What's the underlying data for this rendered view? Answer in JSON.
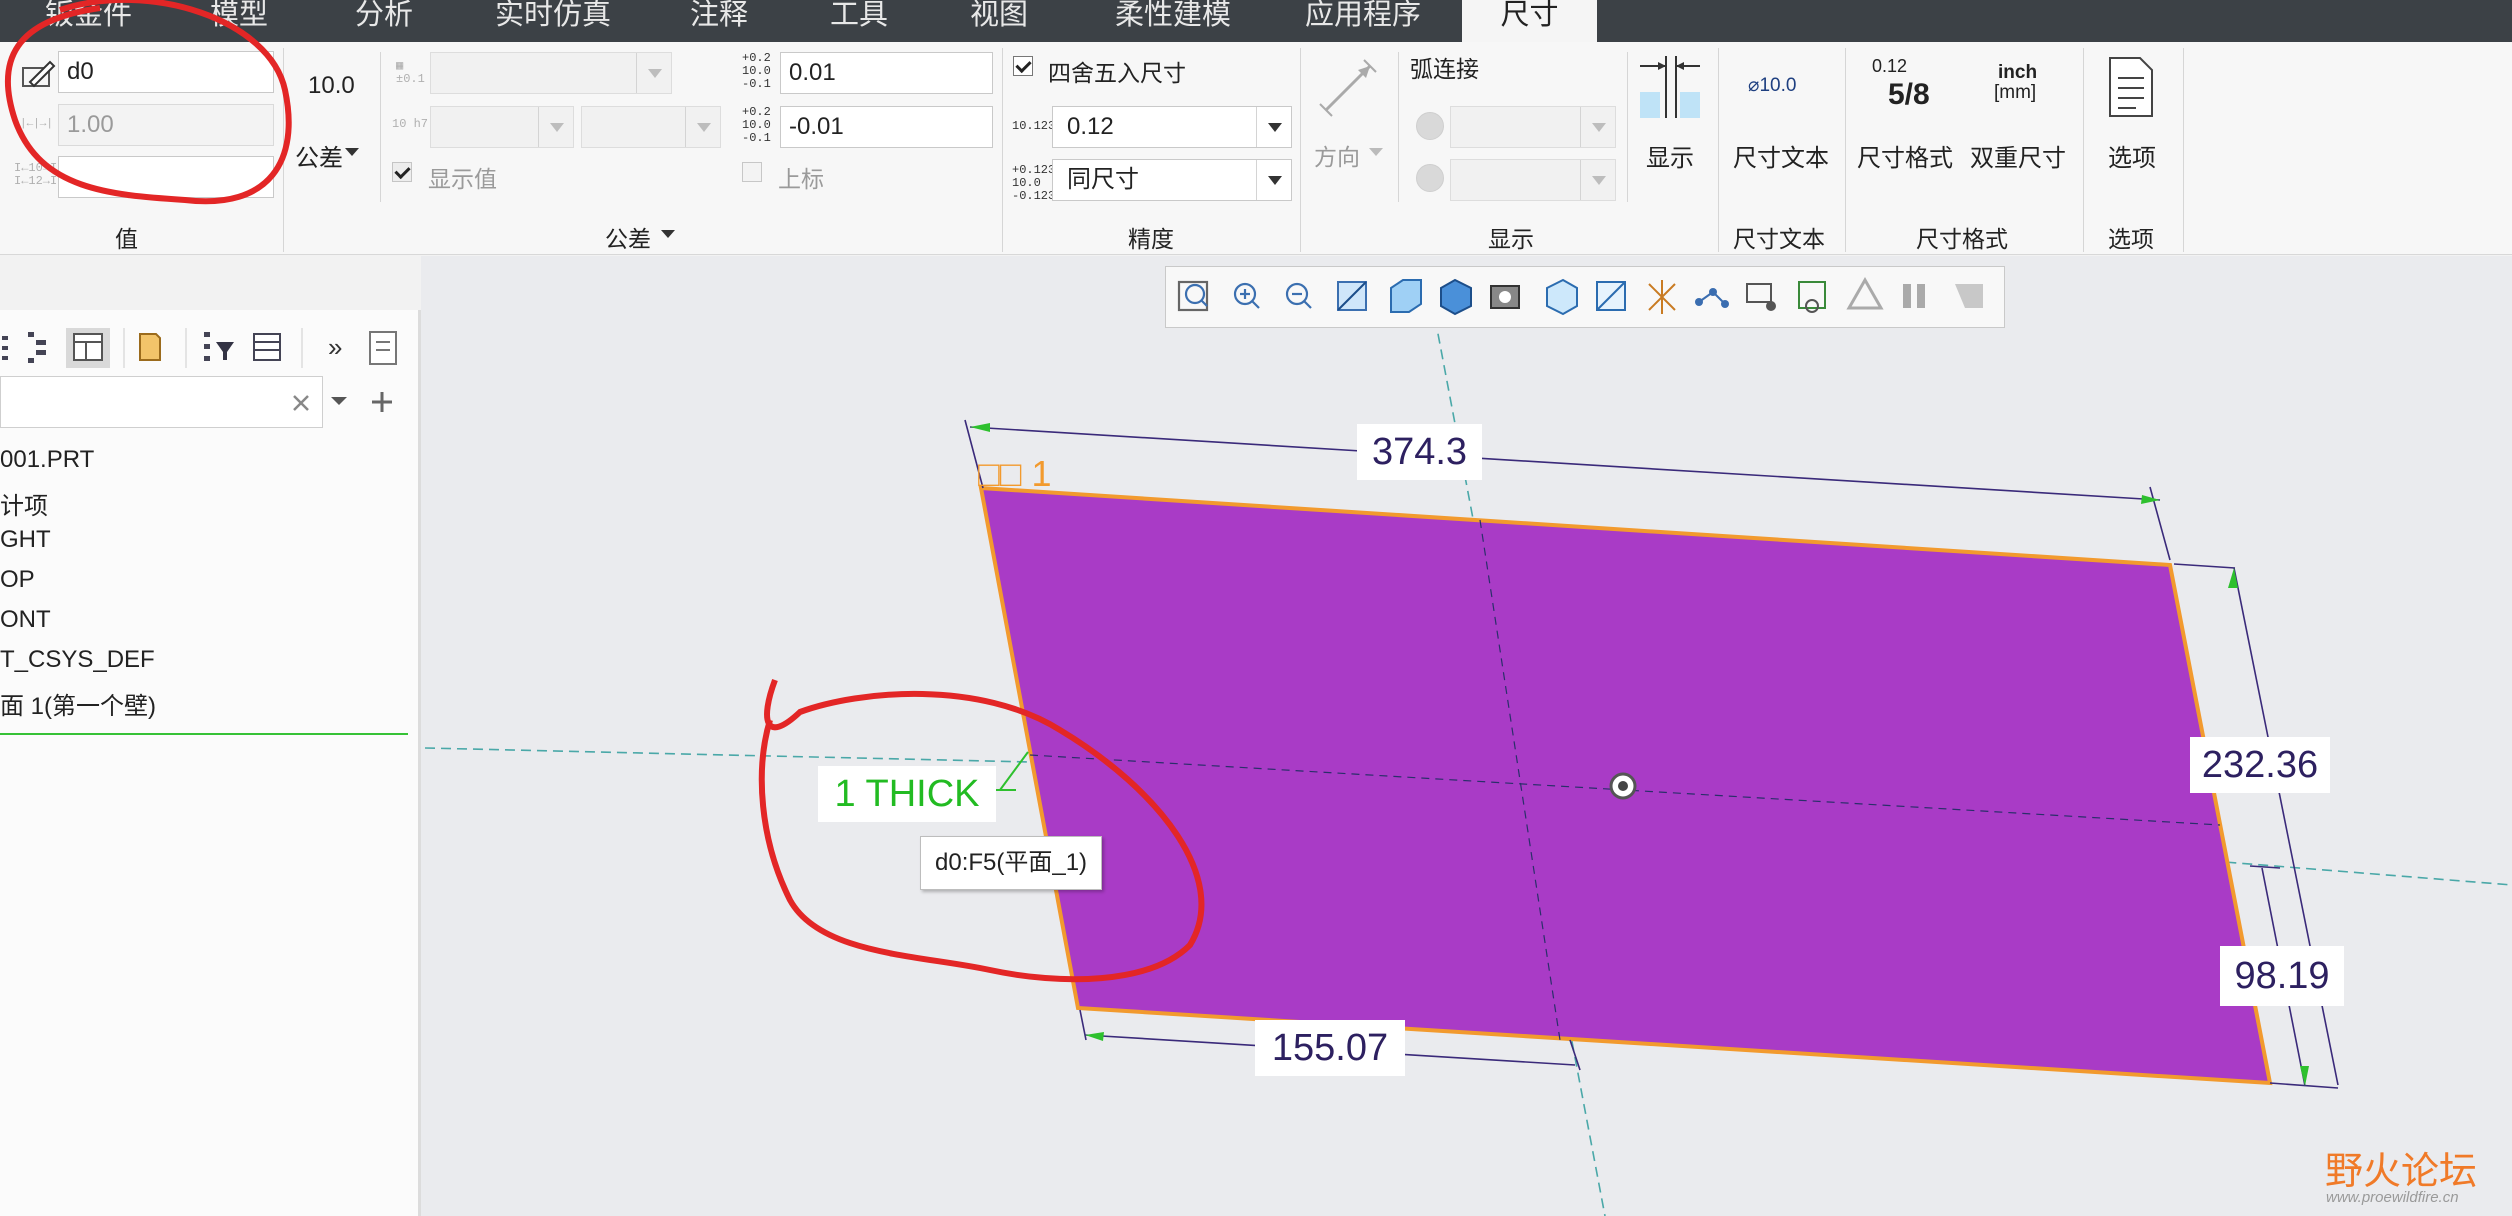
{
  "tabs": [
    "钣金件",
    "模型",
    "分析",
    "实时仿真",
    "注释",
    "工具",
    "视图",
    "柔性建模",
    "应用程序",
    "尺寸"
  ],
  "active_tab": "尺寸",
  "ribbon": {
    "value_group": {
      "label": "值",
      "name_value": "d0",
      "value_placeholder": "1.00",
      "third_value": ""
    },
    "tolerance_group": {
      "label": "公差",
      "tolerance_icon_text": "10.0",
      "tolerance_button_label": "公差",
      "fit_prefix": "10 h7",
      "show_value_label": "显示值",
      "upper_value": "0.01",
      "lower_value": "-0.01",
      "superscript_label": "上标",
      "icon_upper": "+0.2\n10.0\n-0.1",
      "icon_lower": "+0.2\n10.0\n-0.1"
    },
    "precision_group": {
      "label": "精度",
      "round_label": "四舍五入尺寸",
      "round_checked": true,
      "decimal_value": "0.12",
      "decimal_icon": "10.123",
      "tol_precision_value": "同尺寸",
      "tol_precision_icon": "+0.123\n10.0\n-0.123"
    },
    "display_group": {
      "label": "显示",
      "direction_label": "方向",
      "arc_label": "弧连接",
      "show_button_label": "显示"
    },
    "dim_text_group": {
      "label": "尺寸文本",
      "button_label": "尺寸文本",
      "icon_text": "⌀10.0"
    },
    "dim_format_group": {
      "label": "尺寸格式",
      "format_button_label": "尺寸格式",
      "dual_button_label": "双重尺寸",
      "format_icon_top": "0.12",
      "format_icon_frac": "5/8",
      "dual_icon_top": "inch",
      "dual_icon_bottom": "[mm]"
    },
    "options_group": {
      "label": "选项",
      "button_label": "选项"
    }
  },
  "left_panel": {
    "search_value": "",
    "tree_items": [
      "001.PRT",
      "计项",
      "GHT",
      "OP",
      "ONT",
      "T_CSYS_DEF",
      "面 1(第一个壁)"
    ]
  },
  "view_toolbar_icons": [
    "zoom-fit-icon",
    "zoom-in-icon",
    "zoom-out-icon",
    "repaint-icon",
    "display-style-icon",
    "saved-orientations-icon",
    "view-manager-icon",
    "perspective-icon",
    "section-icon",
    "datum-display-icon",
    "point-display-icon",
    "annotation-display-icon",
    "spin-center-icon",
    "appearance-icon",
    "pause-icon",
    "feature-icon"
  ],
  "graphics": {
    "dim_top": "374.3",
    "dim_right": "232.36",
    "dim_right_lower": "98.19",
    "dim_bottom": "155.07",
    "thick_label": "1 THICK",
    "tooltip": "d0:F5(平面_1)",
    "feature_label": "□□ 1",
    "surface_color": "#a93bc6",
    "edge_color": "#f29a2e",
    "annotation_color": "#e32626"
  },
  "watermark": {
    "brand": "野火论坛",
    "url": "www.proewildfire.cn"
  }
}
